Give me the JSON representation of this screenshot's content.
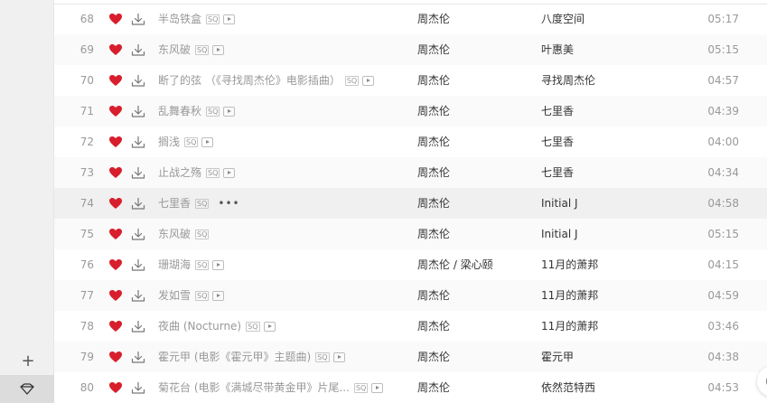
{
  "sidebar": {
    "add_label": "+"
  },
  "songs": [
    {
      "index": "68",
      "title": "半岛铁盒",
      "sq": "SQ",
      "mv": true,
      "more": false,
      "artist": "周杰伦",
      "album": "八度空间",
      "duration": "05:17"
    },
    {
      "index": "69",
      "title": "东风破",
      "sq": "SQ",
      "mv": true,
      "more": false,
      "artist": "周杰伦",
      "album": "叶惠美",
      "duration": "05:15"
    },
    {
      "index": "70",
      "title": "断了的弦 （《寻找周杰伦》电影插曲）",
      "sq": "SQ",
      "mv": true,
      "more": false,
      "artist": "周杰伦",
      "album": "寻找周杰伦",
      "duration": "04:57"
    },
    {
      "index": "71",
      "title": "乱舞春秋",
      "sq": "SQ",
      "mv": true,
      "more": false,
      "artist": "周杰伦",
      "album": "七里香",
      "duration": "04:39"
    },
    {
      "index": "72",
      "title": "搁浅",
      "sq": "SQ",
      "mv": true,
      "more": false,
      "artist": "周杰伦",
      "album": "七里香",
      "duration": "04:00"
    },
    {
      "index": "73",
      "title": "止战之殇",
      "sq": "SQ",
      "mv": true,
      "more": false,
      "artist": "周杰伦",
      "album": "七里香",
      "duration": "04:34"
    },
    {
      "index": "74",
      "title": "七里香",
      "sq": "SQ",
      "mv": false,
      "more": true,
      "artist": "周杰伦",
      "album": "Initial J",
      "duration": "04:58"
    },
    {
      "index": "75",
      "title": "东风破",
      "sq": "SQ",
      "mv": false,
      "more": false,
      "artist": "周杰伦",
      "album": "Initial J",
      "duration": "05:15"
    },
    {
      "index": "76",
      "title": "珊瑚海",
      "sq": "SQ",
      "mv": true,
      "more": false,
      "artist": "周杰伦 / 梁心颐",
      "album": "11月的萧邦",
      "duration": "04:15"
    },
    {
      "index": "77",
      "title": "发如雪",
      "sq": "SQ",
      "mv": true,
      "more": false,
      "artist": "周杰伦",
      "album": "11月的萧邦",
      "duration": "04:59"
    },
    {
      "index": "78",
      "title": "夜曲 (Nocturne)",
      "sq": "SQ",
      "mv": true,
      "more": false,
      "artist": "周杰伦",
      "album": "11月的萧邦",
      "duration": "03:46"
    },
    {
      "index": "79",
      "title": "霍元甲 (电影《霍元甲》主题曲)",
      "sq": "SQ",
      "mv": true,
      "more": false,
      "artist": "周杰伦",
      "album": "霍元甲",
      "duration": "04:38"
    },
    {
      "index": "80",
      "title": "菊花台 (电影《满城尽带黄金甲》片尾...",
      "sq": "SQ",
      "mv": true,
      "more": false,
      "artist": "周杰伦",
      "album": "依然范特西",
      "duration": "04:53"
    }
  ],
  "more_label": "•••",
  "colors": {
    "heart": "#d81e2c",
    "meta": "#999999",
    "text": "#333333",
    "row_alt": "#fafafa",
    "row_hover": "#f0f0f0"
  },
  "icons": {
    "heart": "heart-icon",
    "download": "download-icon",
    "mv": "mv-play-icon",
    "add": "plus-icon",
    "locate": "locate-icon"
  }
}
